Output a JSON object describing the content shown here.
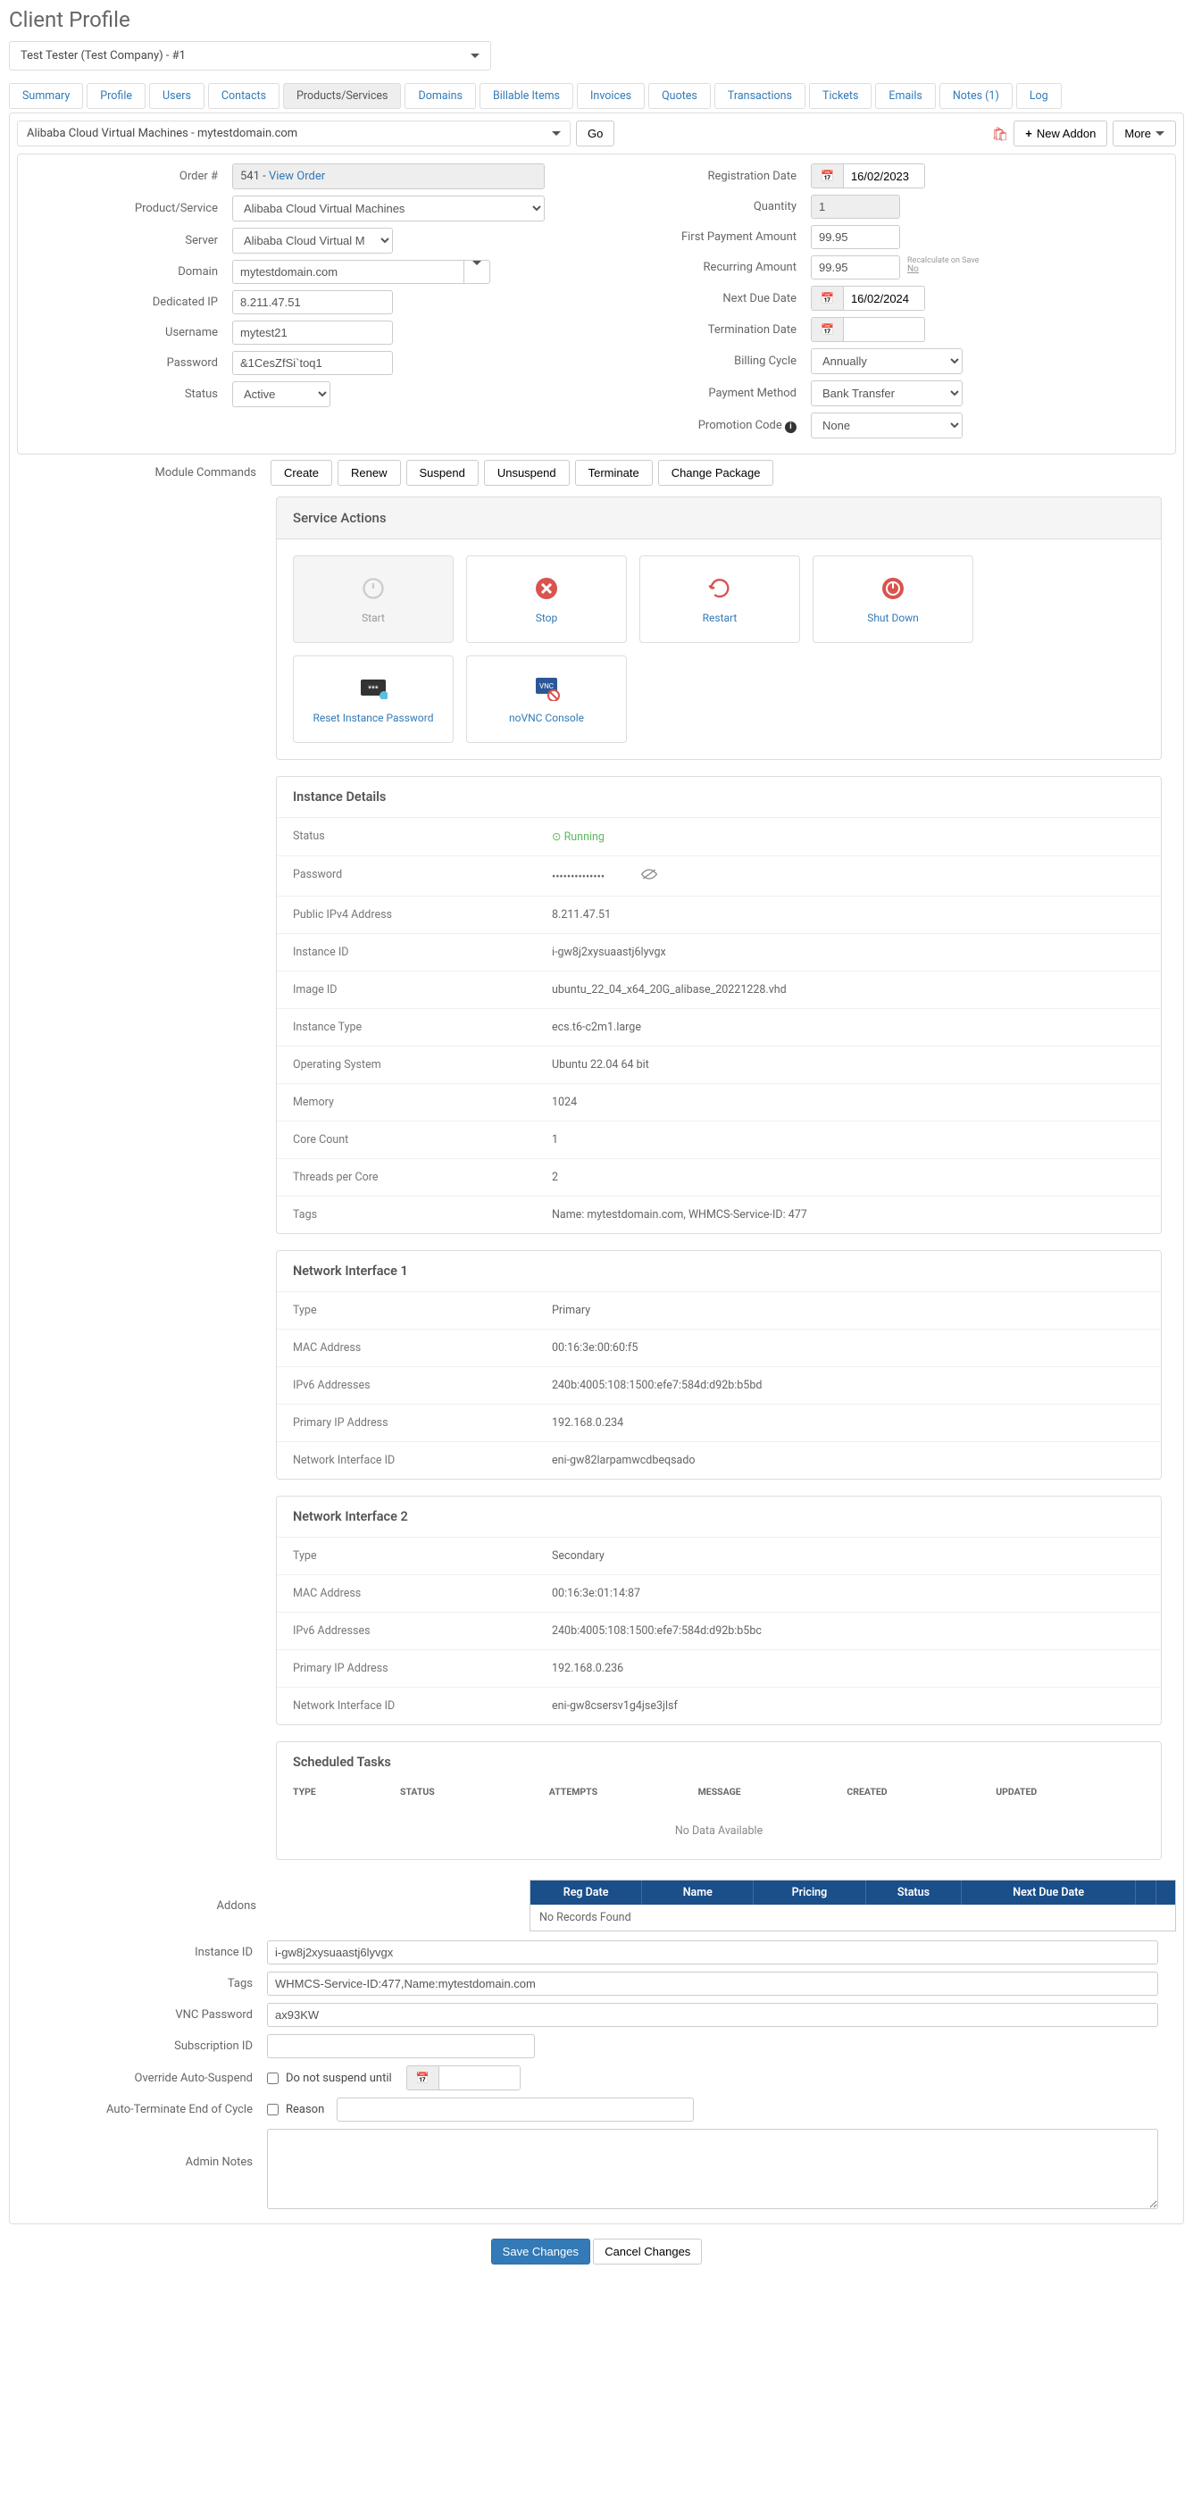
{
  "page_title": "Client Profile",
  "client_selector": "Test Tester (Test Company) - #1",
  "tabs": [
    "Summary",
    "Profile",
    "Users",
    "Contacts",
    "Products/Services",
    "Domains",
    "Billable Items",
    "Invoices",
    "Quotes",
    "Transactions",
    "Tickets",
    "Emails",
    "Notes (1)",
    "Log"
  ],
  "active_tab": "Products/Services",
  "product_selector": "Alibaba Cloud Virtual Machines - mytestdomain.com",
  "go_btn": "Go",
  "new_addon_btn": "New Addon",
  "more_btn": "More",
  "left": {
    "order_no": {
      "label": "Order #",
      "value": "541 - ",
      "link": "View Order"
    },
    "product_service": {
      "label": "Product/Service",
      "value": "Alibaba Cloud Virtual Machines"
    },
    "server": {
      "label": "Server",
      "value": "Alibaba Cloud Virtual M"
    },
    "domain": {
      "label": "Domain",
      "value": "mytestdomain.com"
    },
    "dedicated_ip": {
      "label": "Dedicated IP",
      "value": "8.211.47.51"
    },
    "username": {
      "label": "Username",
      "value": "mytest21"
    },
    "password": {
      "label": "Password",
      "value": "&1CesZfSi`toq1"
    },
    "status": {
      "label": "Status",
      "value": "Active"
    }
  },
  "right": {
    "reg_date": {
      "label": "Registration Date",
      "value": "16/02/2023"
    },
    "quantity": {
      "label": "Quantity",
      "value": "1"
    },
    "first_payment": {
      "label": "First Payment Amount",
      "value": "99.95"
    },
    "recurring": {
      "label": "Recurring Amount",
      "value": "99.95",
      "recalc": "Recalculate on Save",
      "recalc_no": "No"
    },
    "next_due": {
      "label": "Next Due Date",
      "value": "16/02/2024"
    },
    "termination": {
      "label": "Termination Date",
      "value": ""
    },
    "billing_cycle": {
      "label": "Billing Cycle",
      "value": "Annually"
    },
    "payment_method": {
      "label": "Payment Method",
      "value": "Bank Transfer"
    },
    "promo": {
      "label": "Promotion Code",
      "value": "None"
    }
  },
  "module_commands": {
    "label": "Module Commands",
    "buttons": [
      "Create",
      "Renew",
      "Suspend",
      "Unsuspend",
      "Terminate",
      "Change Package"
    ]
  },
  "service_actions": {
    "title": "Service Actions",
    "actions": [
      {
        "name": "Start",
        "disabled": true
      },
      {
        "name": "Stop"
      },
      {
        "name": "Restart"
      },
      {
        "name": "Shut Down"
      },
      {
        "name": "Reset Instance Password"
      },
      {
        "name": "noVNC Console"
      }
    ]
  },
  "instance_details": {
    "title": "Instance Details",
    "rows": [
      {
        "k": "Status",
        "v": "Running",
        "status": true
      },
      {
        "k": "Password",
        "v": "••••••••••••••",
        "eye": true
      },
      {
        "k": "Public IPv4 Address",
        "v": "8.211.47.51"
      },
      {
        "k": "Instance ID",
        "v": "i-gw8j2xysuaastj6lyvgx"
      },
      {
        "k": "Image ID",
        "v": "ubuntu_22_04_x64_20G_alibase_20221228.vhd"
      },
      {
        "k": "Instance Type",
        "v": "ecs.t6-c2m1.large"
      },
      {
        "k": "Operating System",
        "v": "Ubuntu 22.04 64 bit"
      },
      {
        "k": "Memory",
        "v": "1024"
      },
      {
        "k": "Core Count",
        "v": "1"
      },
      {
        "k": "Threads per Core",
        "v": "2"
      },
      {
        "k": "Tags",
        "v": "Name: mytestdomain.com, WHMCS-Service-ID: 477"
      }
    ]
  },
  "net1": {
    "title": "Network Interface 1",
    "rows": [
      {
        "k": "Type",
        "v": "Primary"
      },
      {
        "k": "MAC Address",
        "v": "00:16:3e:00:60:f5"
      },
      {
        "k": "IPv6 Addresses",
        "v": "240b:4005:108:1500:efe7:584d:d92b:b5bd"
      },
      {
        "k": "Primary IP Address",
        "v": "192.168.0.234"
      },
      {
        "k": "Network Interface ID",
        "v": "eni-gw82larpamwcdbeqsado"
      }
    ]
  },
  "net2": {
    "title": "Network Interface 2",
    "rows": [
      {
        "k": "Type",
        "v": "Secondary"
      },
      {
        "k": "MAC Address",
        "v": "00:16:3e:01:14:87"
      },
      {
        "k": "IPv6 Addresses",
        "v": "240b:4005:108:1500:efe7:584d:d92b:b5bc"
      },
      {
        "k": "Primary IP Address",
        "v": "192.168.0.236"
      },
      {
        "k": "Network Interface ID",
        "v": "eni-gw8csersv1g4jse3jlsf"
      }
    ]
  },
  "tasks": {
    "title": "Scheduled Tasks",
    "cols": [
      "TYPE",
      "STATUS",
      "ATTEMPTS",
      "MESSAGE",
      "CREATED",
      "UPDATED"
    ],
    "nodata": "No Data Available"
  },
  "addons": {
    "label": "Addons",
    "cols": [
      "Reg Date",
      "Name",
      "Pricing",
      "Status",
      "Next Due Date"
    ],
    "norecord": "No Records Found"
  },
  "bottom": {
    "instance_id": {
      "label": "Instance ID",
      "value": "i-gw8j2xysuaastj6lyvgx"
    },
    "tags": {
      "label": "Tags",
      "value": "WHMCS-Service-ID:477,Name:mytestdomain.com"
    },
    "vnc": {
      "label": "VNC Password",
      "value": "ax93KW"
    },
    "sub": {
      "label": "Subscription ID",
      "value": ""
    },
    "override": {
      "label": "Override Auto-Suspend",
      "text": "Do not suspend until"
    },
    "autoterm": {
      "label": "Auto-Terminate End of Cycle",
      "text": "Reason"
    },
    "notes": {
      "label": "Admin Notes"
    }
  },
  "save": "Save Changes",
  "cancel": "Cancel Changes"
}
